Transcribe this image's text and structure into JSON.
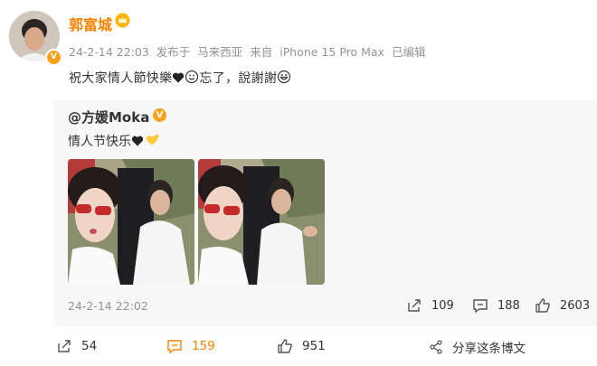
{
  "post": {
    "author": "郭富城",
    "timestamp": "24-2-14 22:03",
    "posted_in_label": "发布于",
    "location": "马来西亚",
    "source_label": "来自",
    "device": "iPhone 15 Pro Max",
    "edited_label": "已编辑",
    "text_before_heart": "祝大家情人節快樂",
    "text_after_smile": "忘了，說謝謝"
  },
  "repost": {
    "author": "@方媛Moka",
    "text": "情人节快乐",
    "timestamp": "24-2-14 22:02",
    "reposts": "109",
    "comments": "188",
    "likes": "2603"
  },
  "footer": {
    "reposts": "54",
    "comments": "159",
    "likes": "951",
    "share_label": "分享这条博文"
  },
  "colors": {
    "accent": "#ff8200",
    "muted": "#939393",
    "repost_bg": "#f7f7f7"
  },
  "icons": [
    "crown-icon",
    "verified-badge-icon",
    "heart-icon",
    "smile-icon",
    "laugh-icon",
    "sparkle-heart-icon",
    "repost-icon",
    "comment-icon",
    "like-icon",
    "share-icon"
  ]
}
